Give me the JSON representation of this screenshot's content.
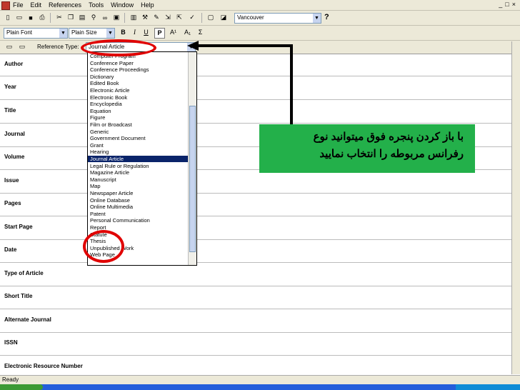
{
  "menu": {
    "items": [
      "File",
      "Edit",
      "References",
      "Tools",
      "Window",
      "Help"
    ],
    "window_controls": [
      "_",
      "□",
      "×"
    ]
  },
  "toolbar": {
    "output_style": "Vancouver",
    "help": "?"
  },
  "format_bar": {
    "font": "Plain Font",
    "size": "Plain Size",
    "bold": "B",
    "italic": "I",
    "underline": "U",
    "plain": "P",
    "superscript": "A¹",
    "subscript": "A₁",
    "symbol": "Σ"
  },
  "reference": {
    "type_label": "Reference Type:",
    "type_value": "Journal Article"
  },
  "fields": [
    "Author",
    "Year",
    "Title",
    "Journal",
    "Volume",
    "Issue",
    "Pages",
    "Start Page",
    "Date",
    "Type of Article",
    "Short Title",
    "Alternate Journal",
    "ISSN",
    "Electronic Resource Number"
  ],
  "dropdown_items": [
    "Computer Program",
    "Conference Paper",
    "Conference Proceedings",
    "Dictionary",
    "Edited Book",
    "Electronic Article",
    "Electronic Book",
    "Encyclopedia",
    "Equation",
    "Figure",
    "Film or Broadcast",
    "Generic",
    "Government Document",
    "Grant",
    "Hearing",
    "Journal Article",
    "Legal Rule or Regulation",
    "Magazine Article",
    "Manuscript",
    "Map",
    "Newspaper Article",
    "Online Database",
    "Online Multimedia",
    "Patent",
    "Personal Communication",
    "Report",
    "Statute",
    "Thesis",
    "Unpublished Work",
    "Web Page"
  ],
  "selected_index": 15,
  "annotation": {
    "line1": "با باز کردن پنجره فوق میتوانید نوع",
    "line2": "رفرانس مربوطه را انتخاب نمایید",
    "bg_color": "#23b04a",
    "ellipse_color": "#e00000"
  },
  "status": "Ready"
}
